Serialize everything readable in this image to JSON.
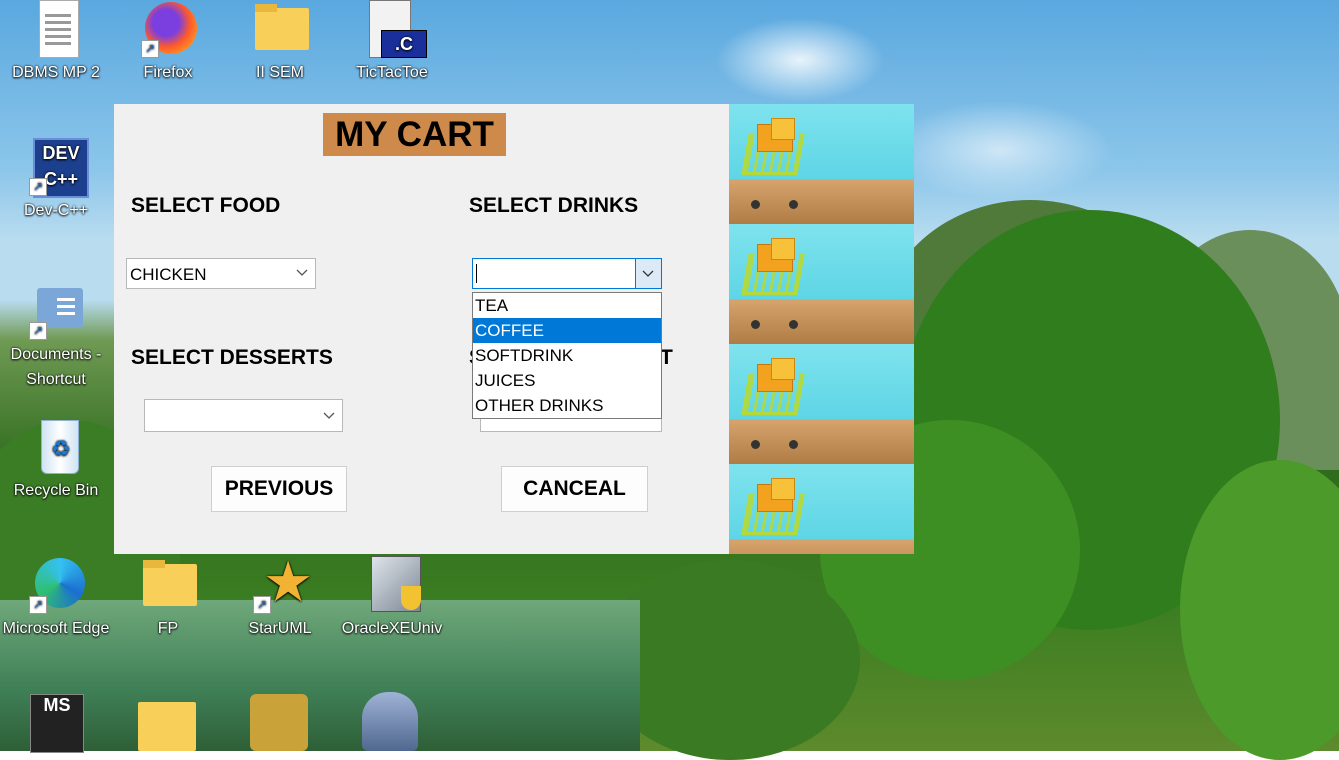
{
  "desktop": {
    "icons": [
      {
        "label": "DBMS MP 2",
        "icon": "document-icon"
      },
      {
        "label": "Firefox",
        "icon": "firefox-icon"
      },
      {
        "label": "II SEM",
        "icon": "folder-icon"
      },
      {
        "label": "TicTacToe",
        "icon": "c-source-file-icon"
      },
      {
        "label": "Dev-C++",
        "icon": "devcpp-icon"
      },
      {
        "label": "Documents - Shortcut",
        "icon": "documents-icon"
      },
      {
        "label": "Recycle Bin",
        "icon": "recycle-bin-icon"
      },
      {
        "label": "Microsoft Edge",
        "icon": "edge-icon"
      },
      {
        "label": "FP",
        "icon": "folder-icon"
      },
      {
        "label": "StarUML",
        "icon": "staruml-icon"
      },
      {
        "label": "OracleXEUniv",
        "icon": "oracle-installer-icon"
      }
    ]
  },
  "app": {
    "title": "MY CART",
    "food_label": "SELECT FOOD",
    "food_value": "CHICKEN",
    "drinks_label": "SELECT DRINKS",
    "drinks_value": "",
    "desserts_label": "SELECT DESSERTS",
    "desserts_value": "",
    "hidden_label_start": "S",
    "hidden_label_end": "T",
    "drinks_options": [
      "TEA",
      "COFFEE",
      "SOFTDRINK",
      "JUICES",
      "OTHER DRINKS"
    ],
    "drinks_highlighted": "COFFEE",
    "previous_button": "PREVIOUS",
    "cancel_button": "CANCEAL"
  },
  "colors": {
    "title_bg": "#cd8a4a",
    "window_bg": "#f0f0f0",
    "highlight": "#0078d7"
  }
}
